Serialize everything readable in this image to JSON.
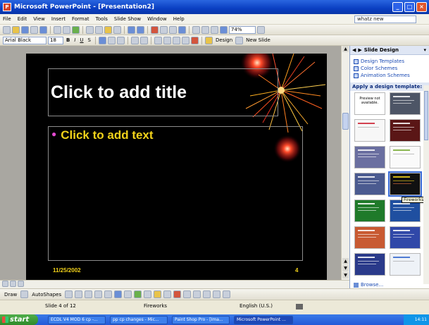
{
  "window": {
    "title": "Microsoft PowerPoint - [Presentation2]",
    "app_icon": "P"
  },
  "window_buttons": {
    "minimize": "_",
    "maximize": "□",
    "close": "×"
  },
  "menu": {
    "items": [
      "File",
      "Edit",
      "View",
      "Insert",
      "Format",
      "Tools",
      "Slide Show",
      "Window",
      "Help"
    ],
    "ask_question": "whatz new"
  },
  "standard_toolbar": {
    "zoom": "74%"
  },
  "format_toolbar": {
    "font": "Arial Black",
    "font_size": "18",
    "bold": "B",
    "italic": "I",
    "underline": "U",
    "shadow": "S",
    "design_label": "Design",
    "new_slide_label": "New Slide"
  },
  "slide": {
    "title_placeholder": "Click to add title",
    "body_placeholder": "Click to add text",
    "date": "11/25/2002",
    "page_number": "4",
    "background": "#000000",
    "title_color": "#ffffff",
    "body_color": "#f2d21a"
  },
  "task_pane": {
    "title": "Slide Design",
    "links": [
      "Design Templates",
      "Color Schemes",
      "Animation Schemes"
    ],
    "apply_label": "Apply a design template:",
    "no_preview": "Preview not available.",
    "tooltip": "Fireworks",
    "browse_label": "Browse..."
  },
  "drawing_toolbar": {
    "draw_label": "Draw",
    "autoshapes_label": "AutoShapes"
  },
  "status": {
    "slide_info": "Slide 4 of 12",
    "design_name": "Fireworks",
    "language": "English (U.S.)"
  },
  "taskbar": {
    "start_label": "start",
    "tasks": [
      "ECDL V4 MOD 6 cp -...",
      "pp cp changes - Mic...",
      "Paint Shop Pro - [Ima...",
      "Microsoft PowerPoint ..."
    ],
    "clock": "14:11"
  }
}
